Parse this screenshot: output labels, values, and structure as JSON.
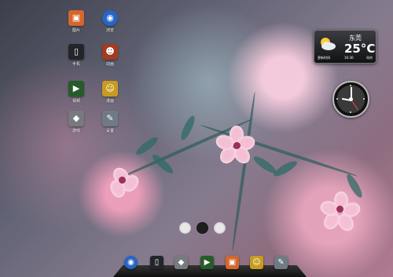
{
  "apps": [
    {
      "id": "gallery",
      "label": "图片",
      "icon": "photo-gallery-icon",
      "glyph": "▣",
      "color": "#d5662d"
    },
    {
      "id": "browser",
      "label": "浏览",
      "icon": "globe-browser-icon",
      "glyph": "◉",
      "color": "#2765c4"
    },
    {
      "id": "phone",
      "label": "手机",
      "icon": "mobile-phone-icon",
      "glyph": "▯",
      "color": "#22252a"
    },
    {
      "id": "animation",
      "label": "动画",
      "icon": "monkey-king-icon",
      "glyph": "☻",
      "color": "#a13b21"
    },
    {
      "id": "video",
      "label": "视频",
      "icon": "video-player-icon",
      "glyph": "▶",
      "color": "#255c2a"
    },
    {
      "id": "cartoon",
      "label": "漫画",
      "icon": "cartoon-sponge-icon",
      "glyph": "☺",
      "color": "#c89b20"
    },
    {
      "id": "games",
      "label": "游戏",
      "icon": "gamepad-icon",
      "glyph": "◆",
      "color": "#777b80"
    },
    {
      "id": "settings",
      "label": "设置",
      "icon": "settings-tools-icon",
      "glyph": "✎",
      "color": "#6f7a85"
    }
  ],
  "weather": {
    "city": "东莞",
    "temperature": "25°C",
    "status": "更新时间",
    "time": "16:30",
    "detail": "晴朗",
    "icon": "partly-cloudy-icon"
  },
  "clock": {
    "hour_angle": -80,
    "minute_angle": 0,
    "second_angle": 145
  },
  "pager": {
    "active_page": 1,
    "page_count": 3,
    "active_color": "#1e1e1e",
    "inactive_color": "#e8e8e8"
  },
  "dock": [
    {
      "name": "dock-browser-icon",
      "glyph": "◉",
      "color": "#2765c4"
    },
    {
      "name": "dock-phone-icon",
      "glyph": "▯",
      "color": "#22252a"
    },
    {
      "name": "dock-gamepad-icon",
      "glyph": "◆",
      "color": "#777b80"
    },
    {
      "name": "dock-video-player-icon",
      "glyph": "▶",
      "color": "#255c2a"
    },
    {
      "name": "dock-photo-gallery-icon",
      "glyph": "▣",
      "color": "#d5662d"
    },
    {
      "name": "dock-cartoon-sponge-icon",
      "glyph": "☺",
      "color": "#c89b20"
    },
    {
      "name": "dock-settings-tools-icon",
      "glyph": "✎",
      "color": "#6f7a85"
    }
  ],
  "colors": {
    "accent": "#f4bfd4",
    "wallpaper_dark": "#3c3f4b",
    "wallpaper_pink": "#b07a92"
  }
}
